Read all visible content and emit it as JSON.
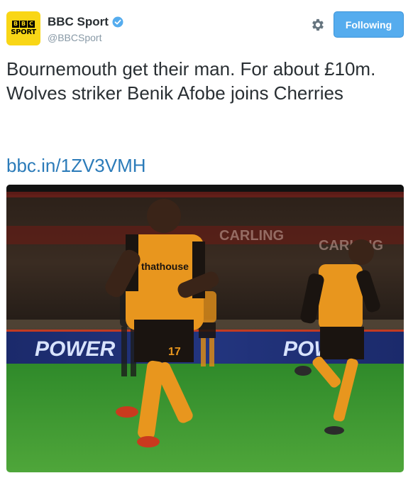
{
  "account": {
    "display_name": "BBC Sport",
    "handle": "@BBCSport",
    "avatar_text_top": [
      "B",
      "B",
      "C"
    ],
    "avatar_text_bottom": "SPORT",
    "verified": true
  },
  "actions": {
    "follow_label": "Following",
    "settings_icon": "gear-icon"
  },
  "tweet": {
    "text": "Bournemouth get their man. For about £10m. Wolves striker Benik Afobe joins Cherries",
    "link": "bbc.in/1ZV3VMH"
  },
  "photo": {
    "board_text_left": "POWER",
    "board_text_right": "POWER",
    "stand_text_1": "CARLING",
    "stand_text_2": "CARLING",
    "shirt_sponsor": "thathouse",
    "shirt_number": "17"
  },
  "colors": {
    "accent": "#55acee",
    "link": "#2b7bb9",
    "handle": "#8899a6",
    "kit_orange": "#e8961e"
  }
}
